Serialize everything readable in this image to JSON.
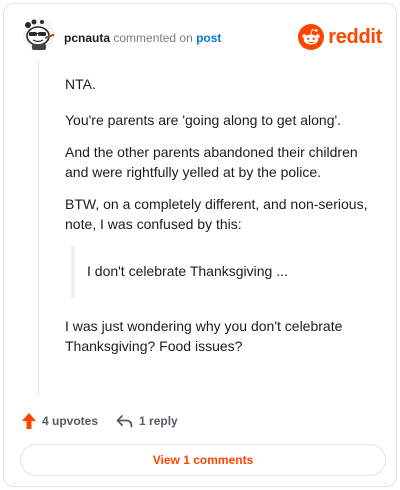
{
  "header": {
    "username": "pcnauta",
    "action": "commented on",
    "post_link": "post",
    "brand_word": "reddit"
  },
  "comment": {
    "paragraphs": [
      "NTA.",
      "You're parents are 'going along to get along'.",
      "And the other parents abandoned their children and were rightfully yelled at by the police.",
      "BTW, on a completely different, and non-serious, note, I was confused by this:"
    ],
    "quote": "I don't celebrate Thanksgiving ...",
    "closing": "I was just wondering why you don't celebrate Thanksgiving? Food issues?"
  },
  "footer": {
    "upvotes_label": "4 upvotes",
    "reply_label": "1 reply"
  },
  "view_comments_label": "View 1 comments",
  "colors": {
    "brand": "#ff4500",
    "link": "#0079d3",
    "muted": "#7c7c7c"
  }
}
